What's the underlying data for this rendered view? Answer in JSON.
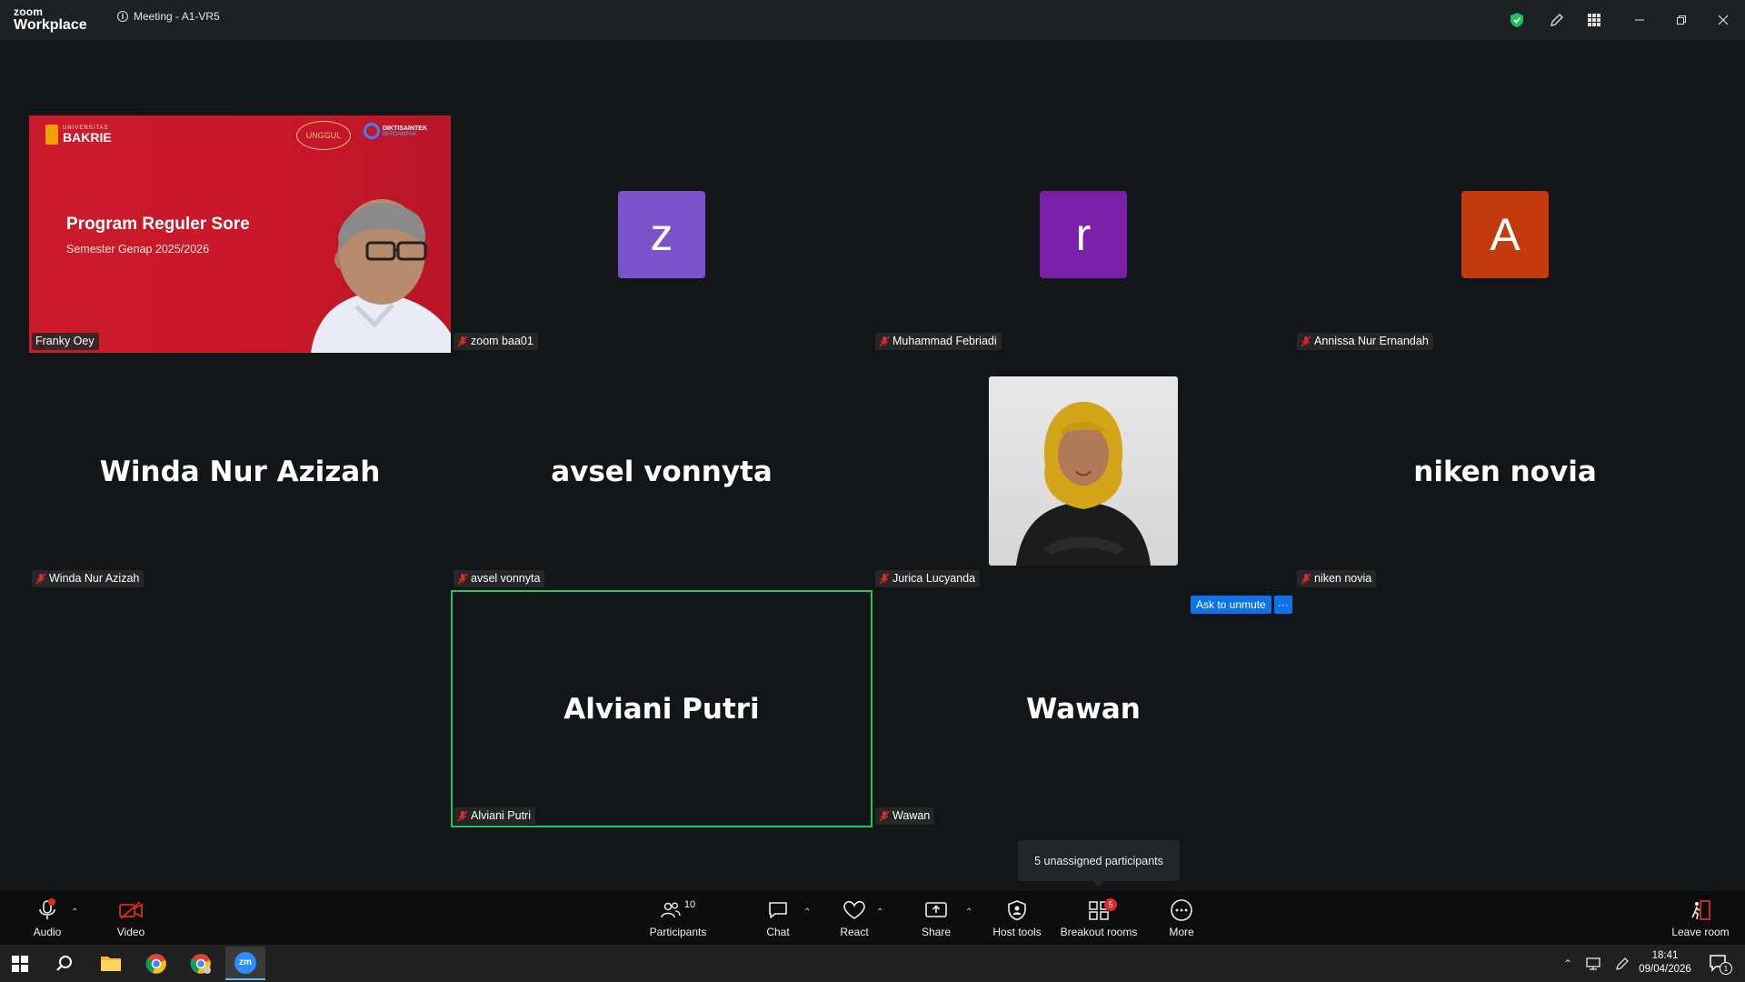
{
  "app": {
    "brand_top": "zoom",
    "brand_bottom": "Workplace",
    "meeting_title": "Meeting - A1-VR5"
  },
  "presenter": {
    "heading": "Program Reguler Sore",
    "subheading": "Semester Genap 2025/2026",
    "logo_text": "BAKRIE",
    "logo_small": "UNIVERSITAS",
    "seal_text": "UNGGUL",
    "brand2_top": "DIKTISAINTEK",
    "brand2_bottom": "BERDAMPAK"
  },
  "tiles": [
    {
      "name": "Franky Oey",
      "muted": false
    },
    {
      "name": "zoom baa01",
      "avatar": "z",
      "avatar_color": "#7b52c9",
      "muted": true
    },
    {
      "name": "Muhammad Febriadi",
      "avatar": "r",
      "avatar_color": "#7a1fa8",
      "muted": true
    },
    {
      "name": "Annissa Nur Ernandah",
      "avatar": "A",
      "avatar_color": "#c33a0f",
      "muted": true
    },
    {
      "name": "Winda Nur Azizah",
      "display": "Winda Nur Azizah",
      "muted": true
    },
    {
      "name": "avsel vonnyta",
      "display": "avsel vonnyta",
      "muted": true
    },
    {
      "name": "Jurica Lucyanda",
      "muted": true
    },
    {
      "name": "niken novia",
      "display": "niken novia",
      "muted": true
    },
    {
      "name": "Alviani Putri",
      "display": "Alviani Putri",
      "muted": true
    },
    {
      "name": "Wawan",
      "display": "Wawan",
      "muted": true
    }
  ],
  "ask_unmute": {
    "label": "Ask to unmute",
    "more": "···"
  },
  "tooltip": "5 unassigned participants",
  "toolbar": {
    "audio": "Audio",
    "video": "Video",
    "participants": "Participants",
    "participants_count": "10",
    "chat": "Chat",
    "react": "React",
    "share": "Share",
    "host_tools": "Host tools",
    "breakout": "Breakout rooms",
    "breakout_badge": "5",
    "more": "More",
    "leave": "Leave room"
  },
  "taskbar": {
    "time": "18:41",
    "date": "09/04/2026",
    "notif_count": "1",
    "app_label": "zm"
  },
  "colors": {
    "accent_green": "#22c55e",
    "ask_blue": "#0e72ed",
    "leave_red": "#e02828"
  }
}
